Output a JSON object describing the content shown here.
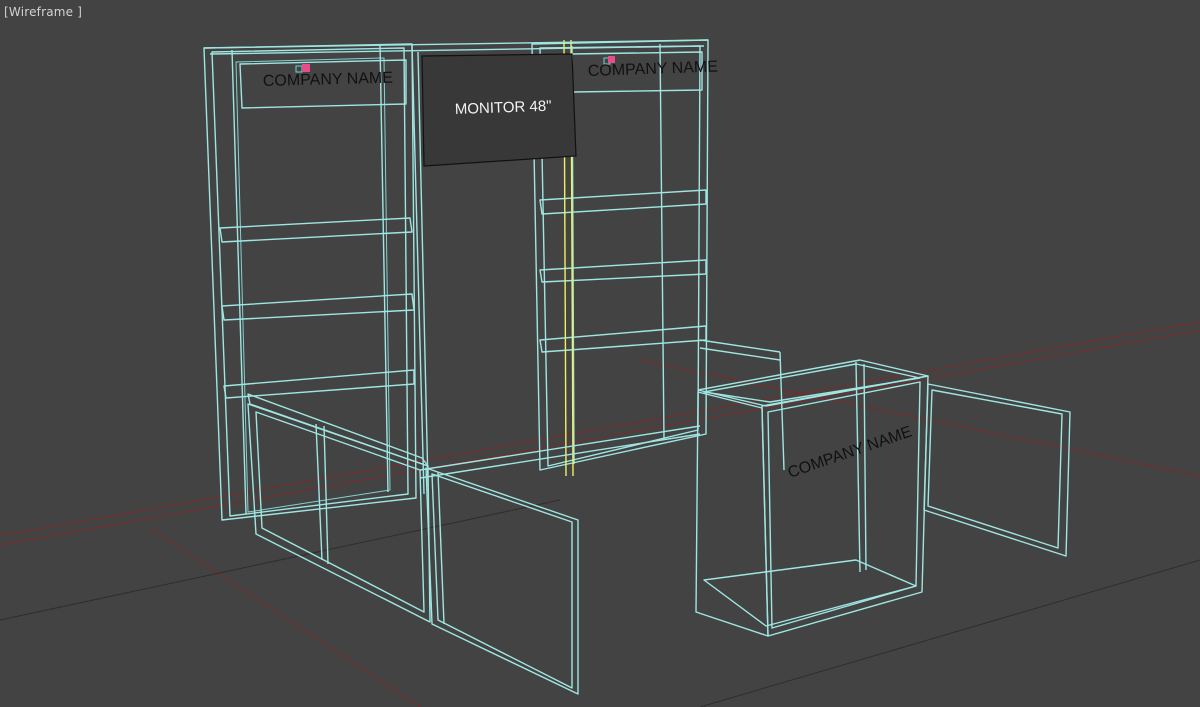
{
  "viewport": {
    "label": "Wireframe",
    "shading_mode": "wireframe"
  },
  "scene": {
    "labels": {
      "company_left": "COMPANY NAME",
      "company_right": "COMPANY NAME",
      "company_counter": "COMPANY NAME",
      "monitor": "MONITOR 48\""
    }
  },
  "colors": {
    "background": "#434343",
    "wire": "#9fe6e3",
    "grid_axis": "#7a2a2a",
    "selection": "#f0f060",
    "logo_accent": "#e64e8a"
  }
}
